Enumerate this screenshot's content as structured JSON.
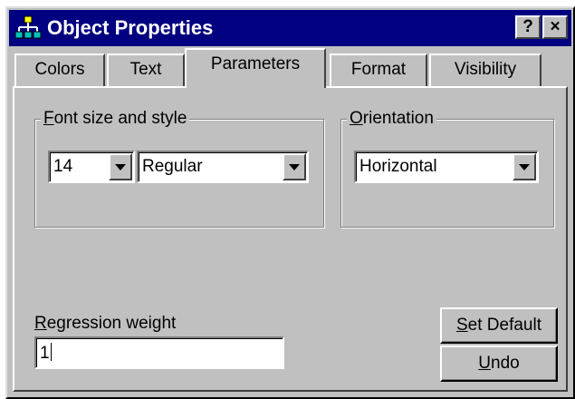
{
  "window": {
    "title": "Object Properties",
    "help_label": "?",
    "close_label": "×"
  },
  "tabs": [
    {
      "label": "Colors",
      "active": false
    },
    {
      "label": "Text",
      "active": false
    },
    {
      "label": "Parameters",
      "active": true
    },
    {
      "label": "Format",
      "active": false
    },
    {
      "label": "Visibility",
      "active": false
    }
  ],
  "font_group": {
    "legend_mnemonic": "F",
    "legend_rest": "ont size and style",
    "size_value": "14",
    "style_value": "Regular"
  },
  "orientation_group": {
    "legend_mnemonic": "O",
    "legend_rest": "rientation",
    "value": "Horizontal"
  },
  "regression": {
    "label_mnemonic": "R",
    "label_rest": "egression weight",
    "value": "1"
  },
  "buttons": {
    "set_default_mnemonic": "S",
    "set_default_rest": "et Default",
    "undo_mnemonic": "U",
    "undo_rest": "ndo"
  },
  "colors": {
    "titlebar": "#000080",
    "face": "#c0c0c0"
  }
}
